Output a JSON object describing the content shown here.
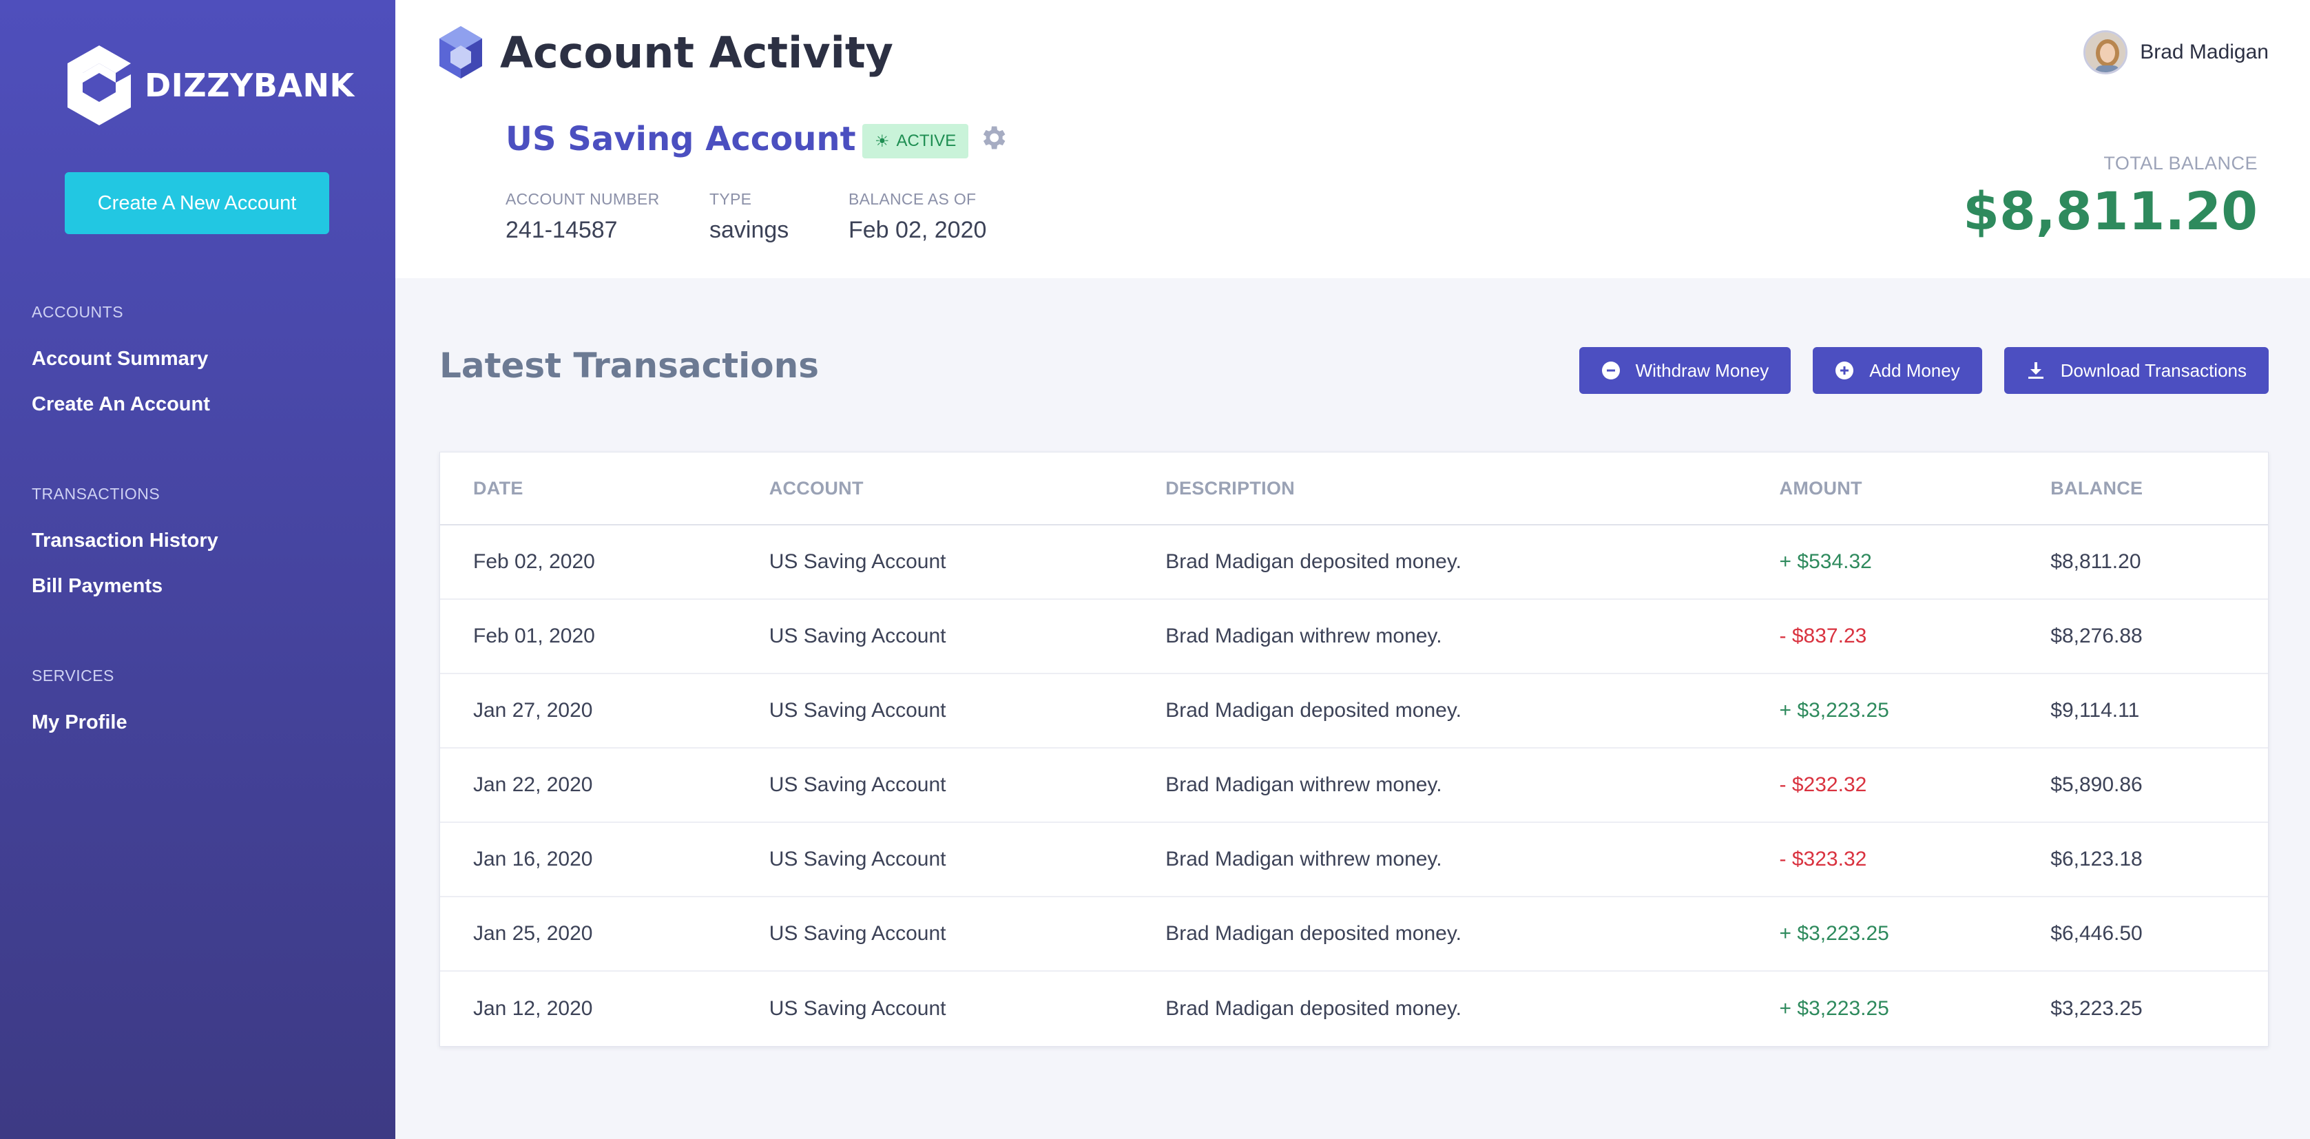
{
  "brand": {
    "name": "DIZZYBANK"
  },
  "sidebar": {
    "create_button": "Create A New Account",
    "sections": [
      {
        "heading": "ACCOUNTS",
        "items": [
          "Account Summary",
          "Create An Account"
        ]
      },
      {
        "heading": "TRANSACTIONS",
        "items": [
          "Transaction History",
          "Bill Payments"
        ]
      },
      {
        "heading": "SERVICES",
        "items": [
          "My Profile"
        ]
      }
    ]
  },
  "header": {
    "title": "Account Activity",
    "user_name": "Brad Madigan"
  },
  "account": {
    "name": "US Saving Account",
    "status": "ACTIVE",
    "number_label": "ACCOUNT NUMBER",
    "number": "241-14587",
    "type_label": "TYPE",
    "type": "savings",
    "balance_as_of_label": "BALANCE AS OF",
    "balance_as_of": "Feb 02, 2020",
    "total_balance_label": "TOTAL BALANCE",
    "total_balance": "$8,811.20"
  },
  "transactions": {
    "title": "Latest Transactions",
    "actions": {
      "withdraw": "Withdraw Money",
      "add": "Add Money",
      "download": "Download Transactions"
    },
    "columns": [
      "DATE",
      "ACCOUNT",
      "DESCRIPTION",
      "AMOUNT",
      "BALANCE"
    ],
    "rows": [
      {
        "date": "Feb 02, 2020",
        "account": "US Saving Account",
        "description": "Brad Madigan deposited money.",
        "amount": "+ $534.32",
        "direction": "in",
        "balance": "$8,811.20"
      },
      {
        "date": "Feb 01, 2020",
        "account": "US Saving Account",
        "description": "Brad Madigan withrew money.",
        "amount": "- $837.23",
        "direction": "out",
        "balance": "$8,276.88"
      },
      {
        "date": "Jan 27, 2020",
        "account": "US Saving Account",
        "description": "Brad Madigan deposited money.",
        "amount": "+ $3,223.25",
        "direction": "in",
        "balance": "$9,114.11"
      },
      {
        "date": "Jan 22, 2020",
        "account": "US Saving Account",
        "description": "Brad Madigan withrew money.",
        "amount": "- $232.32",
        "direction": "out",
        "balance": "$5,890.86"
      },
      {
        "date": "Jan 16, 2020",
        "account": "US Saving Account",
        "description": "Brad Madigan withrew money.",
        "amount": "- $323.32",
        "direction": "out",
        "balance": "$6,123.18"
      },
      {
        "date": "Jan 25, 2020",
        "account": "US Saving Account",
        "description": "Brad Madigan deposited money.",
        "amount": "+ $3,223.25",
        "direction": "in",
        "balance": "$6,446.50"
      },
      {
        "date": "Jan 12, 2020",
        "account": "US Saving Account",
        "description": "Brad Madigan deposited money.",
        "amount": "+ $3,223.25",
        "direction": "in",
        "balance": "$3,223.25"
      }
    ]
  },
  "colors": {
    "sidebar_top": "#4f4fbc",
    "sidebar_bottom": "#3d3a84",
    "accent": "#4c4fc1",
    "cta": "#22c7e2",
    "positive": "#2e8a5d",
    "negative": "#d9323f"
  },
  "icons": {
    "logo": "cube-logo-icon",
    "status": "sun-icon",
    "settings": "gear-icon",
    "withdraw": "minus-circle-icon",
    "add": "plus-circle-icon",
    "download": "download-icon"
  }
}
